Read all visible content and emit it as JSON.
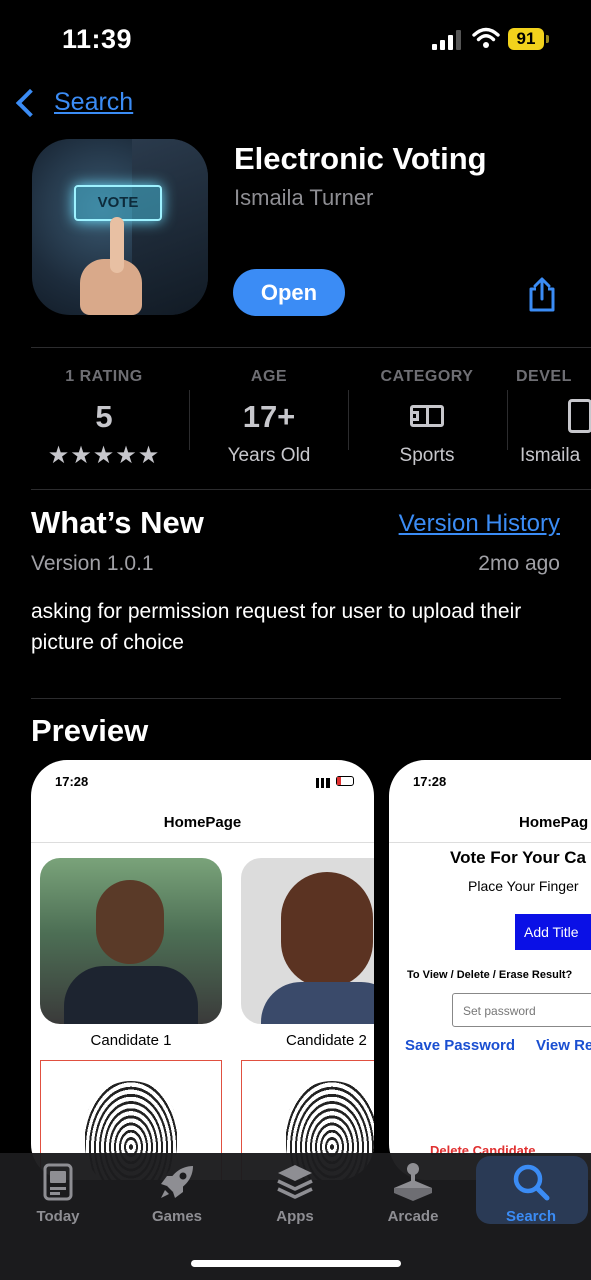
{
  "status": {
    "time": "11:39",
    "battery": "91"
  },
  "nav": {
    "back_label": "Search"
  },
  "app": {
    "title": "Electronic Voting",
    "developer": "Ismaila Turner",
    "open_label": "Open",
    "icon_text": "VOTE"
  },
  "info": {
    "ratings": {
      "header": "1 RATING",
      "value": "5",
      "stars": "★★★★★"
    },
    "age": {
      "header": "AGE",
      "value": "17+",
      "sub": "Years Old"
    },
    "category": {
      "header": "CATEGORY",
      "sub": "Sports"
    },
    "developer": {
      "header": "DEVEL",
      "sub": "Ismaila"
    }
  },
  "whats_new": {
    "title": "What’s New",
    "history_link": "Version History",
    "version": "Version 1.0.1",
    "age": "2mo ago",
    "notes": "asking for permission request for user to upload their picture of choice"
  },
  "preview": {
    "title": "Preview",
    "card1": {
      "time": "17:28",
      "header": "HomePage",
      "candidate1": "Candidate 1",
      "candidate2": "Candidate 2"
    },
    "card2": {
      "time": "17:28",
      "header": "HomePag",
      "heading": "Vote For Your Ca",
      "sub": "Place Your Finger",
      "add_title": "Add Title",
      "view_prompt": "To View / Delete / Erase Result?",
      "password_placeholder": "Set password",
      "save_password": "Save Password",
      "view_result": "View Re",
      "delete_candidate": "Delete Candidate"
    }
  },
  "tabs": [
    {
      "label": "Today",
      "icon": "today-icon"
    },
    {
      "label": "Games",
      "icon": "rocket-icon"
    },
    {
      "label": "Apps",
      "icon": "layers-icon"
    },
    {
      "label": "Arcade",
      "icon": "joystick-icon"
    },
    {
      "label": "Search",
      "icon": "search-icon"
    }
  ],
  "colors": {
    "accent": "#3b8cf5",
    "battery": "#f2d21c",
    "background": "#000000"
  }
}
